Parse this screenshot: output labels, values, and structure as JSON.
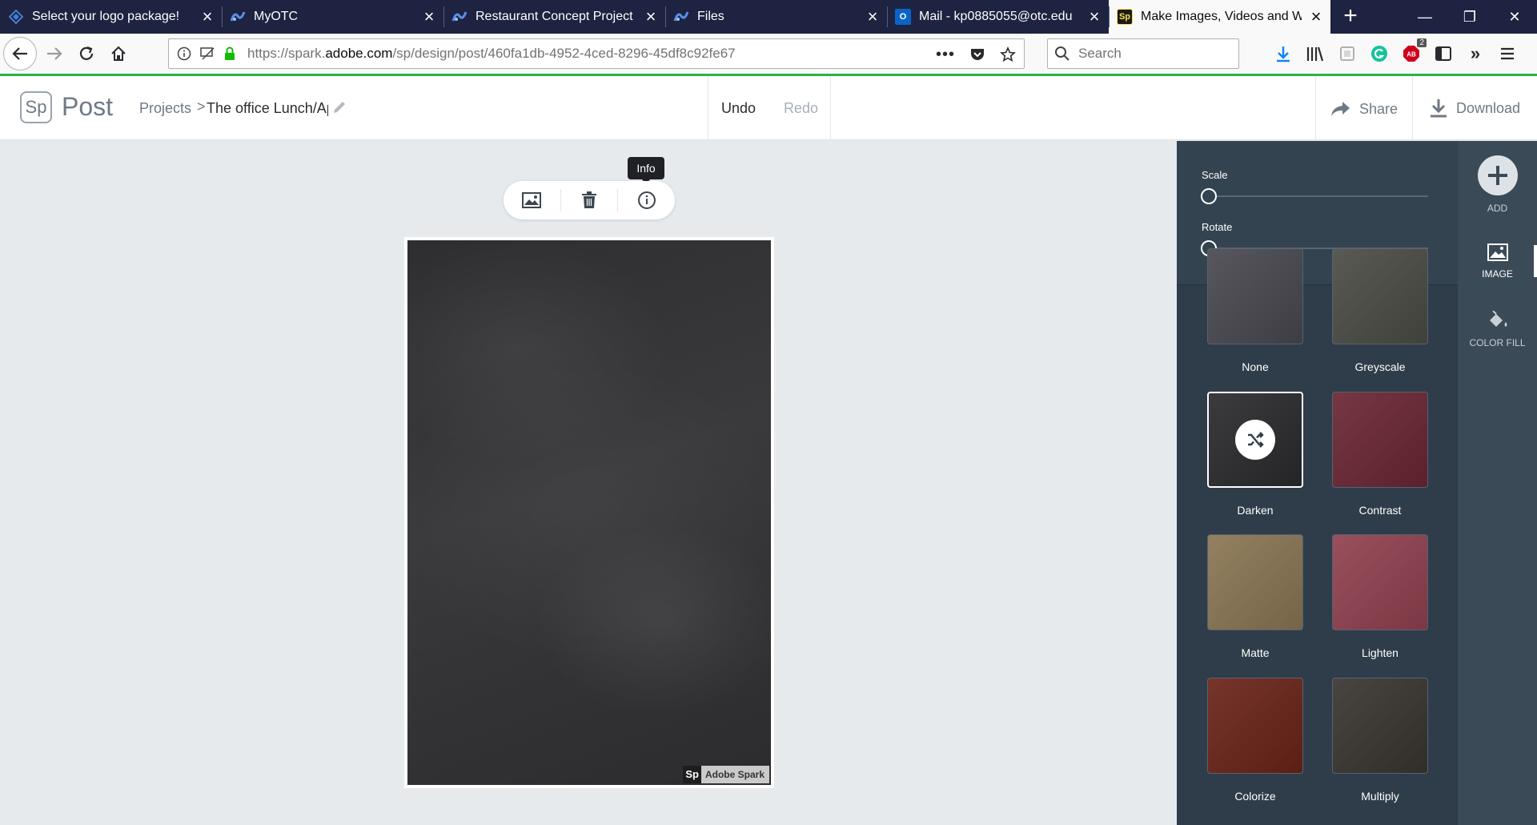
{
  "browser": {
    "tabs": [
      {
        "title": "Select your logo package!",
        "favicon": "diamond-logo-icon",
        "active": false
      },
      {
        "title": "MyOTC",
        "favicon": "otc-logo-icon",
        "active": false
      },
      {
        "title": "Restaurant Concept Project",
        "favicon": "otc-logo-icon",
        "active": false
      },
      {
        "title": "Files",
        "favicon": "otc-logo-icon",
        "active": false
      },
      {
        "title": "Mail - kp0885055@otc.edu",
        "favicon": "outlook-icon",
        "active": false
      },
      {
        "title": "Make Images, Videos and Web",
        "favicon": "spark-icon",
        "active": true
      }
    ],
    "url_prefix": "https://spark.",
    "url_host": "adobe.com",
    "url_path": "/sp/design/post/460fa1db-4952-4ced-8296-45df8c92fe67",
    "search_placeholder": "Search",
    "addon_badge": "2",
    "accent_color": "#2bb24c"
  },
  "app": {
    "logo_text": "Sp",
    "name": "Post",
    "breadcrumb_root": "Projects",
    "breadcrumb_sep": ">",
    "project_title": "The office Lunch/Ap",
    "undo_label": "Undo",
    "redo_label": "Redo",
    "share_label": "Share",
    "download_label": "Download"
  },
  "canvas": {
    "tooltip": "Info",
    "watermark_logo": "Sp",
    "watermark_text": "Adobe Spark"
  },
  "panel": {
    "scale_label": "Scale",
    "rotate_label": "Rotate",
    "scale_value": 0,
    "rotate_value": 0,
    "filters": [
      {
        "label": "None",
        "color": "#4a4850",
        "selected": false
      },
      {
        "label": "Greyscale",
        "color": "#4c4c46",
        "selected": false
      },
      {
        "label": "Darken",
        "color": "#2b2a2d",
        "selected": true
      },
      {
        "label": "Contrast",
        "color": "#6b2634",
        "selected": false
      },
      {
        "label": "Matte",
        "color": "#8a7654",
        "selected": false
      },
      {
        "label": "Lighten",
        "color": "#914150",
        "selected": false
      },
      {
        "label": "Colorize",
        "color": "#6a2418",
        "selected": false
      },
      {
        "label": "Multiply",
        "color": "#3a3530",
        "selected": false
      }
    ]
  },
  "rail": {
    "add_label": "ADD",
    "image_label": "IMAGE",
    "color_fill_label": "COLOR FILL"
  }
}
